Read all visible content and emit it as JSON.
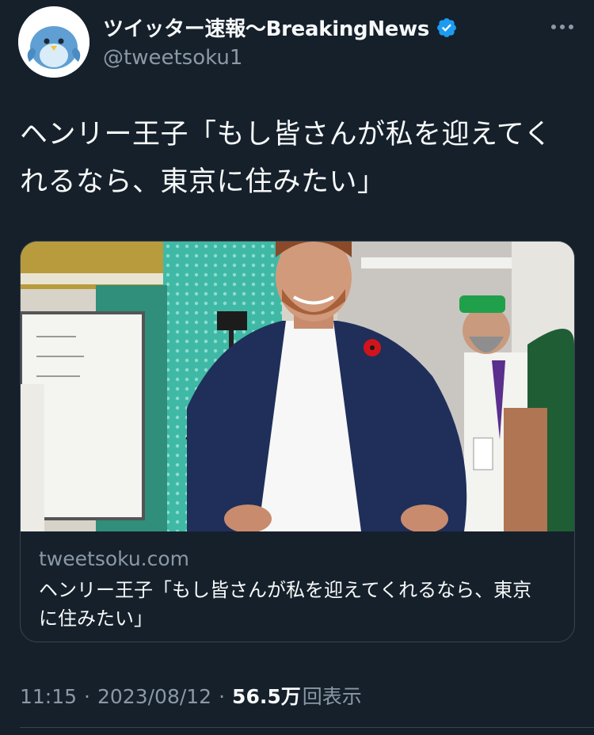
{
  "author": {
    "display_name": "ツイッター速報〜BreakingNews",
    "handle": "@tweetsoku1",
    "avatar_icon": "bird-avatar-icon",
    "verified": true,
    "verified_icon": "verified-badge-icon",
    "verified_color": "#1d9bf0"
  },
  "more_icon": "more-icon",
  "tweet": {
    "text": "ヘンリー王子「もし皆さんが私を迎えてくれるなら、東京に住みたい」"
  },
  "link_card": {
    "image_icon": "article-photo",
    "domain": "tweetsoku.com",
    "title": "ヘンリー王子「もし皆さんが私を迎えてくれるなら、東京に住みたい」"
  },
  "meta": {
    "time": "11:15",
    "date": "2023/08/12",
    "separator": "·",
    "views_count": "56.5万",
    "views_label": "回表示"
  },
  "colors": {
    "background": "#15202b",
    "text_primary": "#f7f9f9",
    "text_secondary": "#8b98a5",
    "border": "#38444d"
  }
}
